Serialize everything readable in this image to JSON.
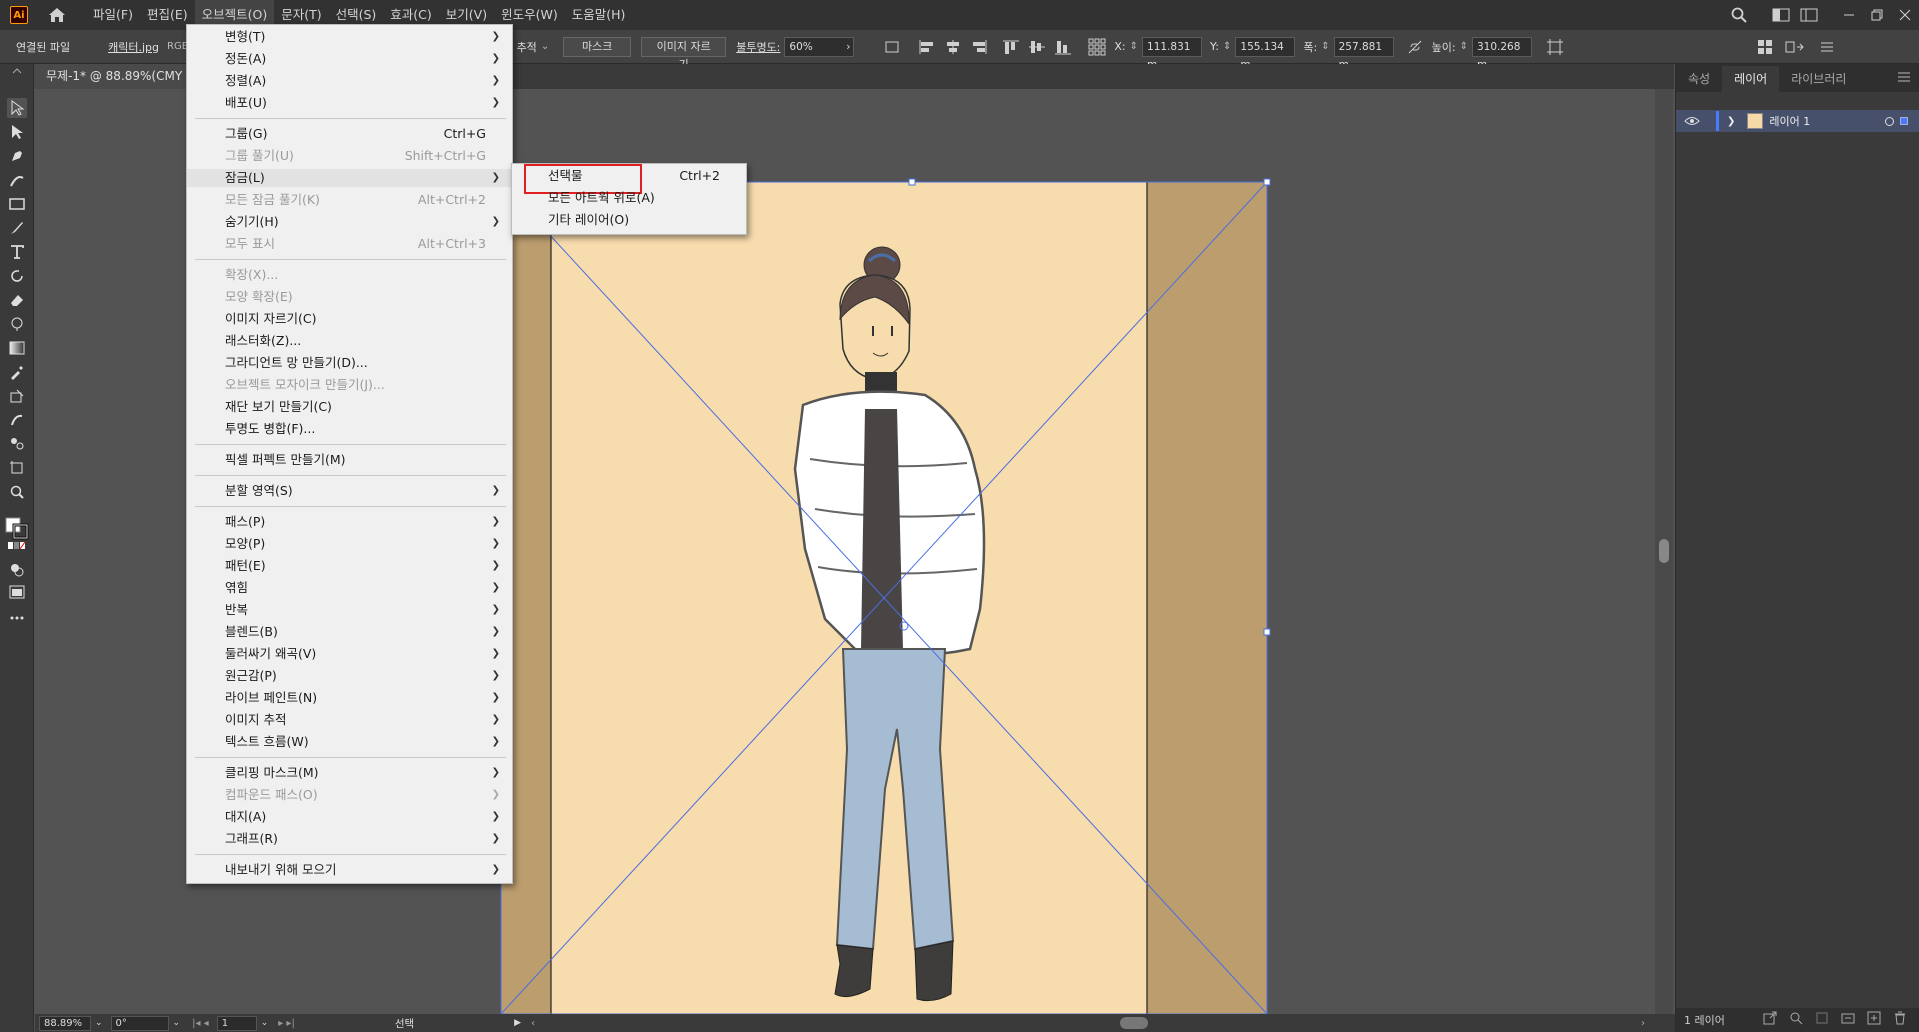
{
  "app": {
    "logo_text": "Ai"
  },
  "menubar": {
    "items": [
      "파일(F)",
      "편집(E)",
      "오브젝트(O)",
      "문자(T)",
      "선택(S)",
      "효과(C)",
      "보기(V)",
      "윈도우(W)",
      "도움말(H)"
    ],
    "active_index": 2
  },
  "controlbar": {
    "linked_file": "연결된 파일",
    "filename": "캐릭터.jpg",
    "color_mode": "RGB",
    "trace_fragment": "추적",
    "mask_label": "마스크",
    "crop_label": "이미지 자르기",
    "opacity_label": "불투명도:",
    "opacity_value": "60%",
    "x_label": "X:",
    "x_value": "111.831 m",
    "y_label": "Y:",
    "y_value": "155.134 m",
    "w_label": "폭:",
    "w_value": "257.881 m",
    "h_label": "높이:",
    "h_value": "310.268 m"
  },
  "document_tab": {
    "title": "무제-1* @ 88.89%(CMY"
  },
  "object_menu": {
    "groups": [
      [
        {
          "label": "변형(T)",
          "submenu": true
        },
        {
          "label": "정돈(A)",
          "submenu": true
        },
        {
          "label": "정렬(A)",
          "submenu": true
        },
        {
          "label": "배포(U)",
          "submenu": true
        }
      ],
      [
        {
          "label": "그룹(G)",
          "shortcut": "Ctrl+G"
        },
        {
          "label": "그룹 풀기(U)",
          "shortcut": "Shift+Ctrl+G",
          "disabled": true
        },
        {
          "label": "잠금(L)",
          "submenu": true,
          "hover": true
        },
        {
          "label": "모든 잠금 풀기(K)",
          "shortcut": "Alt+Ctrl+2",
          "disabled": true
        },
        {
          "label": "숨기기(H)",
          "submenu": true
        },
        {
          "label": "모두 표시",
          "shortcut": "Alt+Ctrl+3",
          "disabled": true
        }
      ],
      [
        {
          "label": "확장(X)...",
          "disabled": true
        },
        {
          "label": "모양 확장(E)",
          "disabled": true
        },
        {
          "label": "이미지 자르기(C)"
        },
        {
          "label": "래스터화(Z)..."
        },
        {
          "label": "그라디언트 망 만들기(D)..."
        },
        {
          "label": "오브젝트 모자이크 만들기(J)...",
          "disabled": true
        },
        {
          "label": "재단 보기 만들기(C)"
        },
        {
          "label": "투명도 병합(F)..."
        }
      ],
      [
        {
          "label": "픽셀 퍼펙트 만들기(M)"
        }
      ],
      [
        {
          "label": "분할 영역(S)",
          "submenu": true
        }
      ],
      [
        {
          "label": "패스(P)",
          "submenu": true
        },
        {
          "label": "모양(P)",
          "submenu": true
        },
        {
          "label": "패턴(E)",
          "submenu": true
        },
        {
          "label": "엮힘",
          "submenu": true
        },
        {
          "label": "반복",
          "submenu": true
        },
        {
          "label": "블렌드(B)",
          "submenu": true
        },
        {
          "label": "둘러싸기 왜곡(V)",
          "submenu": true
        },
        {
          "label": "원근감(P)",
          "submenu": true
        },
        {
          "label": "라이브 페인트(N)",
          "submenu": true
        },
        {
          "label": "이미지 추적",
          "submenu": true
        },
        {
          "label": "텍스트 흐름(W)",
          "submenu": true
        }
      ],
      [
        {
          "label": "클리핑 마스크(M)",
          "submenu": true
        },
        {
          "label": "컴파운드 패스(O)",
          "submenu": true,
          "disabled": true
        },
        {
          "label": "대지(A)",
          "submenu": true
        },
        {
          "label": "그래프(R)",
          "submenu": true
        }
      ],
      [
        {
          "label": "내보내기 위해 모으기",
          "submenu": true
        }
      ]
    ]
  },
  "lock_submenu": {
    "items": [
      {
        "label": "선택물",
        "shortcut": "Ctrl+2",
        "highlighted": true
      },
      {
        "label": "모든 아트웍 위로(A)"
      },
      {
        "label": "기타 레이어(O)"
      }
    ]
  },
  "right_panel": {
    "tabs": [
      "속성",
      "레이어",
      "라이브러리"
    ],
    "active_tab": 1,
    "layers": [
      {
        "name": "레이어 1"
      }
    ],
    "footer_count": "1 레이어"
  },
  "statusbar": {
    "zoom": "88.89%",
    "rotation": "0°",
    "artboard": "1",
    "tool": "선택"
  },
  "colors": {
    "highlight_box": "#e02020",
    "artboard_bg": "#f7dcad",
    "side_bands": "#bb9d6e",
    "bbox": "#4a6ee0"
  }
}
